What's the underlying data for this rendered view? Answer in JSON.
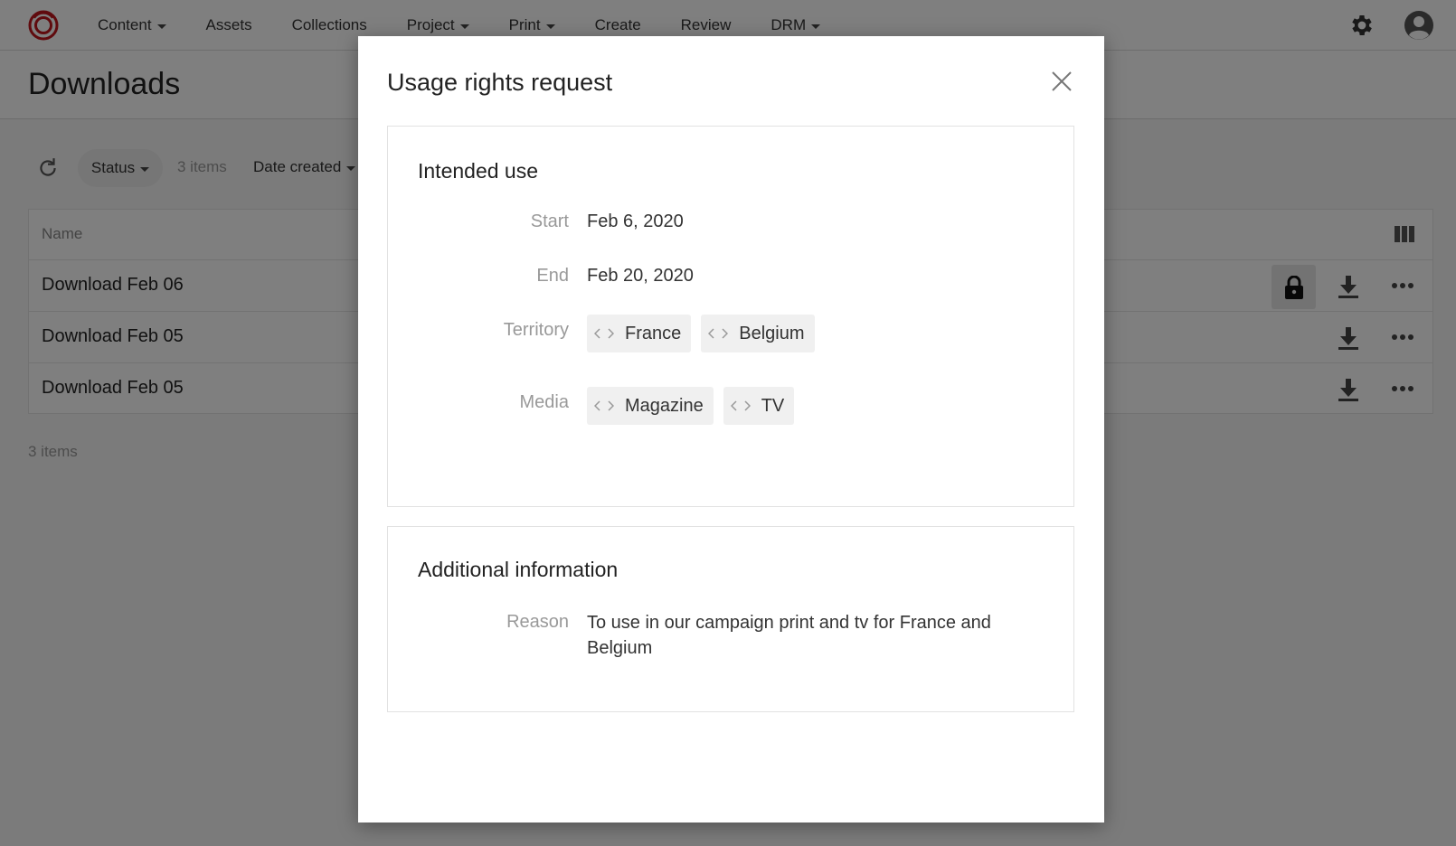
{
  "nav": {
    "items": [
      {
        "label": "Content",
        "dropdown": true
      },
      {
        "label": "Assets",
        "dropdown": false
      },
      {
        "label": "Collections",
        "dropdown": false
      },
      {
        "label": "Project",
        "dropdown": true
      },
      {
        "label": "Print",
        "dropdown": true
      },
      {
        "label": "Create",
        "dropdown": false
      },
      {
        "label": "Review",
        "dropdown": false
      },
      {
        "label": "DRM",
        "dropdown": true
      }
    ],
    "brand_color": "#c0161d"
  },
  "page": {
    "title": "Downloads"
  },
  "toolbar": {
    "status_filter": "Status",
    "items_count": "3 items",
    "sort_label": "Date created"
  },
  "table": {
    "header_name": "Name",
    "rows": [
      {
        "name": "Download Feb 06",
        "locked": true
      },
      {
        "name": "Download Feb 05",
        "locked": false
      },
      {
        "name": "Download Feb 05",
        "locked": false
      }
    ],
    "footer_count": "3 items"
  },
  "modal": {
    "title": "Usage rights request",
    "intended_use": {
      "title": "Intended use",
      "start_label": "Start",
      "start_value": "Feb 6, 2020",
      "end_label": "End",
      "end_value": "Feb 20, 2020",
      "territory_label": "Territory",
      "territories": [
        "France",
        "Belgium"
      ],
      "media_label": "Media",
      "media": [
        "Magazine",
        "TV"
      ]
    },
    "additional": {
      "title": "Additional information",
      "reason_label": "Reason",
      "reason_value": "To use in our campaign print and tv for France and Belgium"
    }
  }
}
